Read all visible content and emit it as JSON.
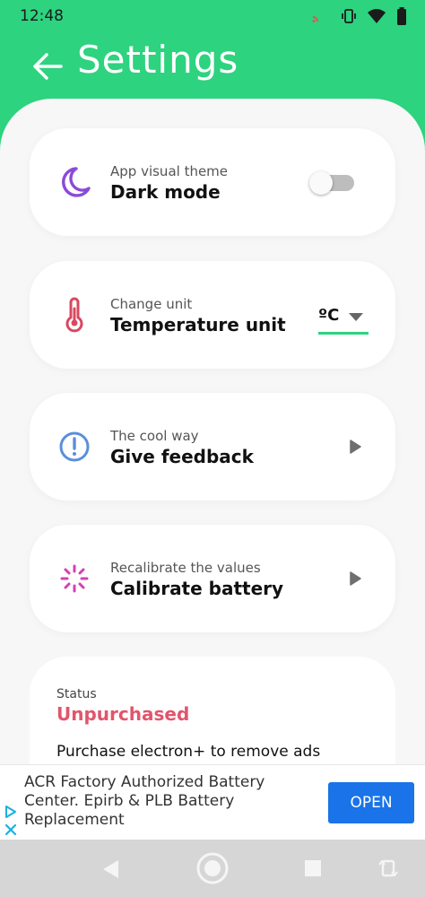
{
  "status_bar": {
    "time": "12:48",
    "icons": [
      "cast-icon",
      "vibrate-icon",
      "wifi-icon",
      "battery-icon"
    ]
  },
  "header": {
    "title": "Settings",
    "back_icon": "arrow-left-icon"
  },
  "colors": {
    "accent": "#2dd37f",
    "moon": "#8a4bd8",
    "thermometer": "#d9485f",
    "feedback": "#5b8fdb",
    "calibrate": "#d63fb6",
    "status_value": "#e2556b",
    "ad_button": "#1a73e8"
  },
  "cards": {
    "dark_mode": {
      "subtitle": "App visual theme",
      "title": "Dark mode",
      "icon": "moon-icon",
      "enabled": false
    },
    "temperature": {
      "subtitle": "Change unit",
      "title": "Temperature unit",
      "icon": "thermometer-icon",
      "selected_unit": "ºC"
    },
    "feedback": {
      "subtitle": "The cool way",
      "title": "Give feedback",
      "icon": "info-circle-icon"
    },
    "calibrate": {
      "subtitle": "Recalibrate the values",
      "title": "Calibrate battery",
      "icon": "loading-spinner-icon"
    }
  },
  "status": {
    "label": "Status",
    "value": "Unpurchased",
    "purchase_text": "Purchase electron+ to remove ads"
  },
  "ad": {
    "text": "ACR Factory Authorized Battery Center. Epirb & PLB Battery Replacement",
    "button_label": "OPEN"
  },
  "nav_bar": {
    "buttons": [
      "back-triangle-icon",
      "home-circle-icon",
      "recents-square-icon",
      "rotate-icon"
    ]
  }
}
